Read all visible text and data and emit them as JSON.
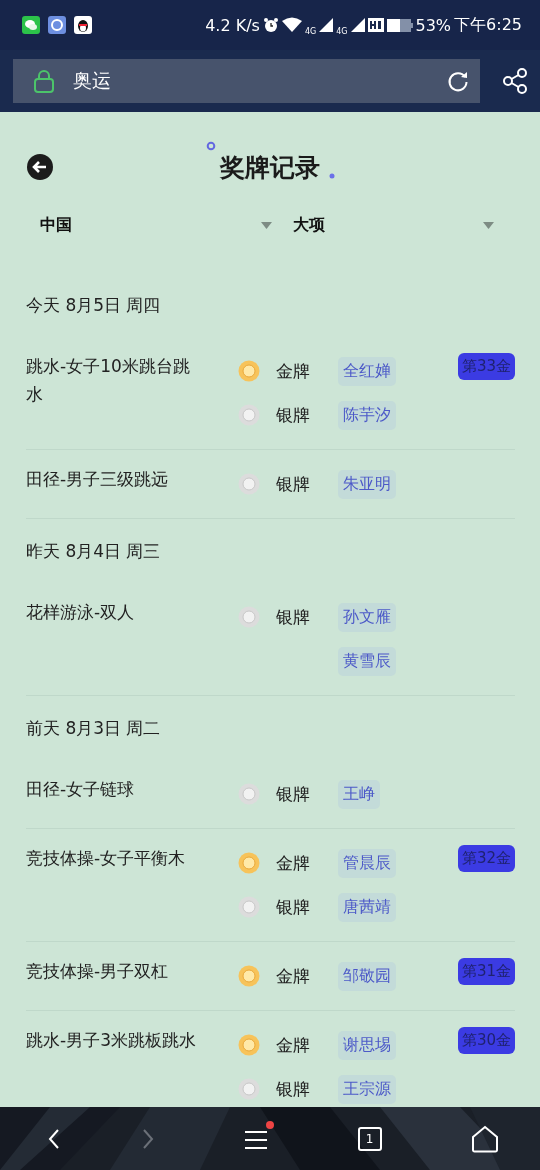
{
  "status_bar": {
    "speed": "4.2 K/s",
    "net1": "4G",
    "net2": "4G",
    "battery_text": "53%",
    "time": "下午6:25"
  },
  "address_bar": {
    "value": "奥运"
  },
  "title": "奖牌记录",
  "filters": [
    {
      "label": "中国"
    },
    {
      "label": "大项"
    }
  ],
  "days": [
    {
      "label": "今天 8月5日 周四",
      "events": [
        {
          "name": "跳水-女子10米跳台跳水",
          "rank": "第33金",
          "medals": [
            {
              "kind": "gold",
              "label": "金牌",
              "athletes": [
                "全红婵"
              ]
            },
            {
              "kind": "silver",
              "label": "银牌",
              "athletes": [
                "陈芋汐"
              ]
            }
          ]
        },
        {
          "name": "田径-男子三级跳远",
          "medals": [
            {
              "kind": "silver",
              "label": "银牌",
              "athletes": [
                "朱亚明"
              ]
            }
          ]
        }
      ]
    },
    {
      "label": "昨天 8月4日 周三",
      "events": [
        {
          "name": "花样游泳-双人",
          "medals": [
            {
              "kind": "silver",
              "label": "银牌",
              "athletes": [
                "孙文雁",
                "黄雪辰"
              ]
            }
          ]
        }
      ]
    },
    {
      "label": "前天 8月3日 周二",
      "events": [
        {
          "name": "田径-女子链球",
          "medals": [
            {
              "kind": "silver",
              "label": "银牌",
              "athletes": [
                "王峥"
              ]
            }
          ]
        },
        {
          "name": "竞技体操-女子平衡木",
          "rank": "第32金",
          "medals": [
            {
              "kind": "gold",
              "label": "金牌",
              "athletes": [
                "管晨辰"
              ]
            },
            {
              "kind": "silver",
              "label": "银牌",
              "athletes": [
                "唐茜靖"
              ]
            }
          ]
        },
        {
          "name": "竞技体操-男子双杠",
          "rank": "第31金",
          "medals": [
            {
              "kind": "gold",
              "label": "金牌",
              "athletes": [
                "邹敬园"
              ]
            }
          ]
        },
        {
          "name": "跳水-男子3米跳板跳水",
          "rank": "第30金",
          "medals": [
            {
              "kind": "gold",
              "label": "金牌",
              "athletes": [
                "谢思埸"
              ]
            },
            {
              "kind": "silver",
              "label": "银牌",
              "athletes": [
                "王宗源"
              ]
            }
          ]
        }
      ]
    }
  ],
  "bottom_nav": {
    "tabs_count": "1",
    "menu_badge": true
  }
}
